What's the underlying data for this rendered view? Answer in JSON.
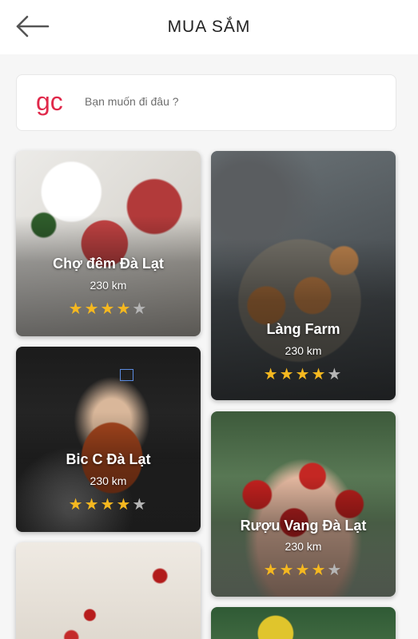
{
  "header": {
    "title": "MUA SẮM",
    "back_icon": "arrow-left-icon"
  },
  "search": {
    "logo_text": "gc",
    "logo_color": "#e0284a",
    "placeholder": "Bạn muốn đi đâu ?"
  },
  "colors": {
    "star_active": "#f5b820",
    "star_inactive": "#b5b5b5"
  },
  "places": [
    {
      "name": "Chợ đêm Đà Lạt",
      "distance": "230 km",
      "rating": 4,
      "max_rating": 5
    },
    {
      "name": "Làng Farm",
      "distance": "230 km",
      "rating": 4,
      "max_rating": 5
    },
    {
      "name": "Bic C Đà Lạt",
      "distance": "230 km",
      "rating": 4,
      "max_rating": 5
    },
    {
      "name": "Rượu Vang Đà Lạt",
      "distance": "230 km",
      "rating": 4,
      "max_rating": 5
    }
  ]
}
